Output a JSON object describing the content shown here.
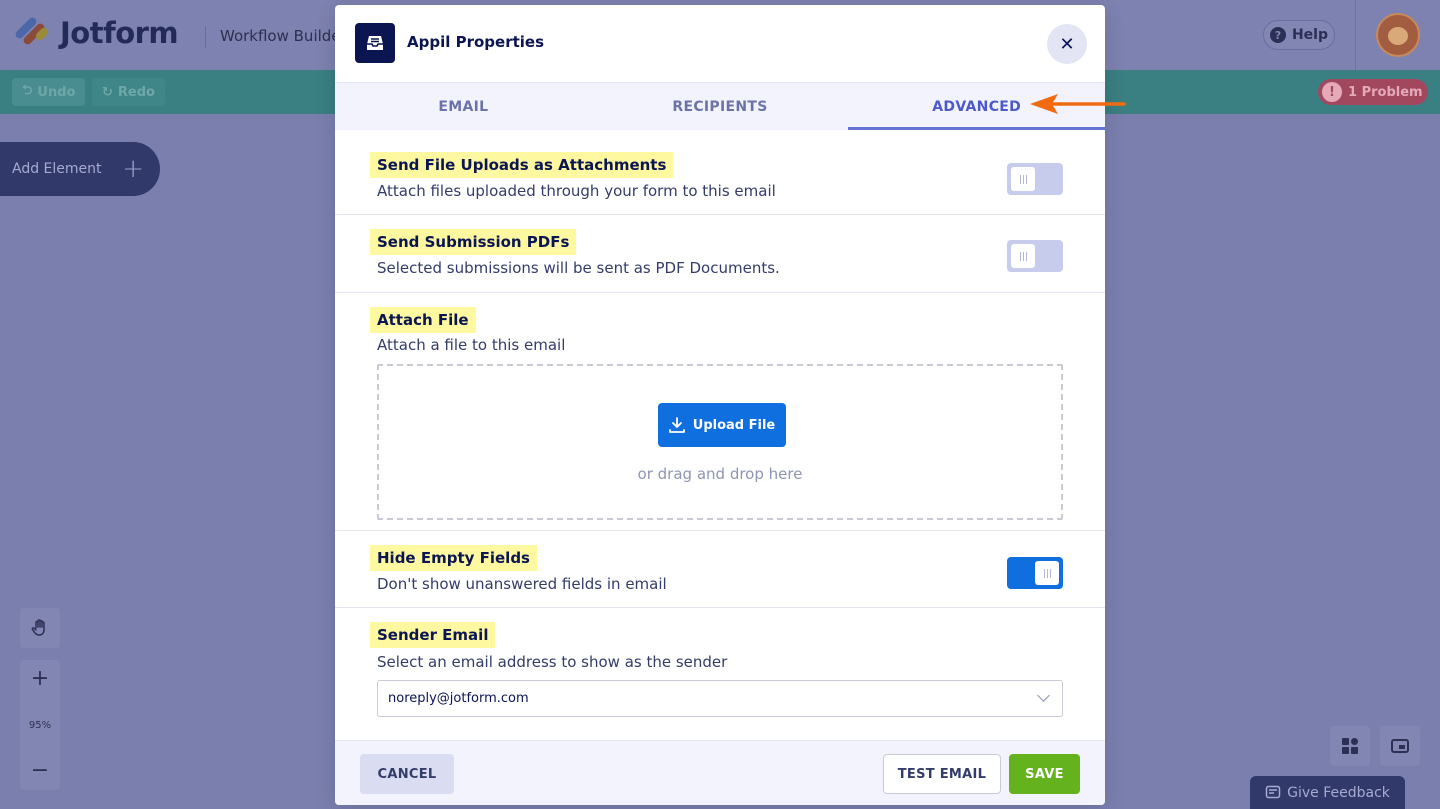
{
  "app": {
    "logo_text": "Jotform",
    "workflow_title": "Workflow Builde",
    "help_label": "Help",
    "undo_label": "Undo",
    "redo_label": "Redo",
    "problem_label": "1 Problem",
    "add_element_label": "Add Element",
    "zoom_level": "95%",
    "feedback_label": "Give Feedback"
  },
  "modal": {
    "title": "Appil Properties",
    "tabs": [
      {
        "label": "EMAIL",
        "active": false
      },
      {
        "label": "RECIPIENTS",
        "active": false
      },
      {
        "label": "ADVANCED",
        "active": true
      }
    ],
    "sections": {
      "attachments": {
        "title": "Send File Uploads as Attachments",
        "desc": "Attach files uploaded through your form to this email",
        "enabled": false
      },
      "pdfs": {
        "title": "Send Submission PDFs",
        "desc": "Selected submissions will be sent as PDF Documents.",
        "enabled": false
      },
      "attach_file": {
        "title": "Attach File",
        "desc": "Attach a file to this email",
        "upload_label": "Upload File",
        "drag_text": "or drag and drop here"
      },
      "hide_empty": {
        "title": "Hide Empty Fields",
        "desc": "Don't show unanswered fields in email",
        "enabled": true
      },
      "sender": {
        "title": "Sender Email",
        "desc": "Select an email address to show as the sender",
        "value": "noreply@jotform.com"
      }
    },
    "footer": {
      "cancel_label": "CANCEL",
      "test_label": "TEST EMAIL",
      "save_label": "SAVE"
    }
  },
  "colors": {
    "accent": "#0f6fdf",
    "save": "#64b21e",
    "highlight": "#fef8a0",
    "annotation_arrow": "#f26a10"
  }
}
